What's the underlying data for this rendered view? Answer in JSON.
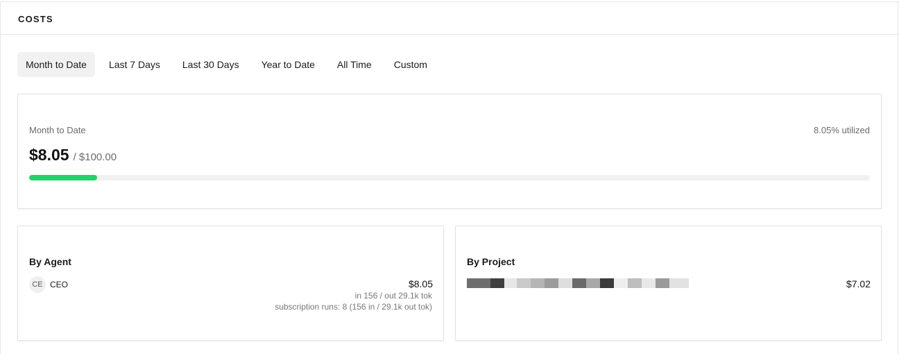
{
  "header": {
    "title": "COSTS"
  },
  "tabs": [
    {
      "label": "Month to Date",
      "active": true
    },
    {
      "label": "Last 7 Days",
      "active": false
    },
    {
      "label": "Last 30 Days",
      "active": false
    },
    {
      "label": "Year to Date",
      "active": false
    },
    {
      "label": "All Time",
      "active": false
    },
    {
      "label": "Custom",
      "active": false
    }
  ],
  "summary": {
    "period_label": "Month to Date",
    "utilized_text": "8.05% utilized",
    "amount": "$8.05",
    "budget": "/ $100.00",
    "progress_fraction": 0.0805,
    "progress_color": "#21d36a"
  },
  "by_agent": {
    "title": "By Agent",
    "items": [
      {
        "avatar_initials": "CE",
        "name": "CEO",
        "cost": "$8.05",
        "tokens": "in 156 / out 29.1k tok",
        "subscription": "subscription runs: 8 (156 in / 29.1k out tok)"
      }
    ]
  },
  "by_project": {
    "title": "By Project",
    "items": [
      {
        "name_redacted": true,
        "cost": "$7.02"
      }
    ]
  }
}
